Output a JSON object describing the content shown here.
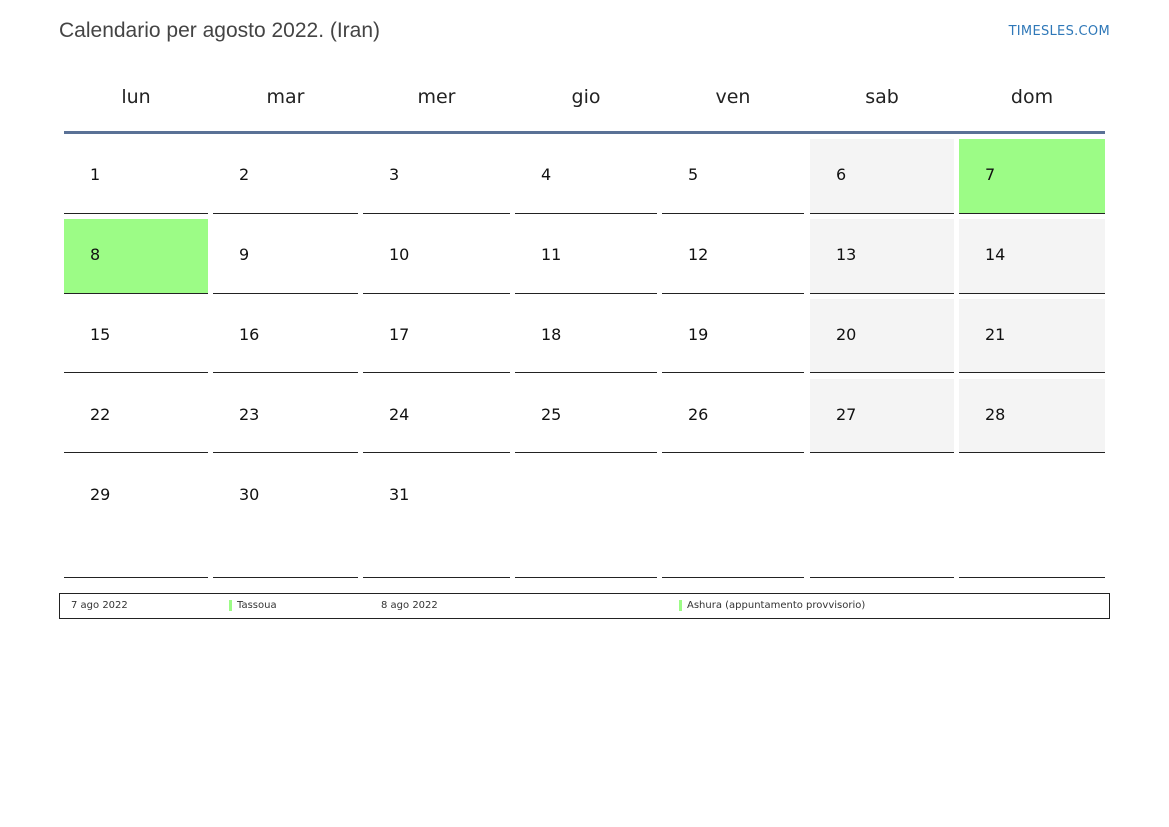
{
  "title": "Calendario per agosto 2022. (Iran)",
  "brand": "TIMESLES.COM",
  "colors": {
    "brand": "#2f78b8",
    "header_rule": "#5a7196",
    "holiday": "#9cfc86",
    "weekend": "#f4f4f4",
    "legend_bar": "#9cfc86"
  },
  "weekdays": [
    "lun",
    "mar",
    "mer",
    "gio",
    "ven",
    "sab",
    "dom"
  ],
  "weeks": [
    [
      {
        "day": "1"
      },
      {
        "day": "2"
      },
      {
        "day": "3"
      },
      {
        "day": "4"
      },
      {
        "day": "5"
      },
      {
        "day": "6",
        "weekend": true
      },
      {
        "day": "7",
        "holiday": true
      }
    ],
    [
      {
        "day": "8",
        "holiday": true
      },
      {
        "day": "9"
      },
      {
        "day": "10"
      },
      {
        "day": "11"
      },
      {
        "day": "12"
      },
      {
        "day": "13",
        "weekend": true
      },
      {
        "day": "14",
        "weekend": true
      }
    ],
    [
      {
        "day": "15"
      },
      {
        "day": "16"
      },
      {
        "day": "17"
      },
      {
        "day": "18"
      },
      {
        "day": "19"
      },
      {
        "day": "20",
        "weekend": true
      },
      {
        "day": "21",
        "weekend": true
      }
    ],
    [
      {
        "day": "22"
      },
      {
        "day": "23"
      },
      {
        "day": "24"
      },
      {
        "day": "25"
      },
      {
        "day": "26"
      },
      {
        "day": "27",
        "weekend": true
      },
      {
        "day": "28",
        "weekend": true
      }
    ],
    [
      {
        "day": "29"
      },
      {
        "day": "30"
      },
      {
        "day": "31"
      },
      {
        "day": ""
      },
      {
        "day": ""
      },
      {
        "day": ""
      },
      {
        "day": ""
      }
    ]
  ],
  "legend": [
    {
      "date": "7 ago 2022",
      "name": "Tassoua"
    },
    {
      "date": "8 ago 2022",
      "name": "Ashura (appuntamento provvisorio)"
    }
  ]
}
